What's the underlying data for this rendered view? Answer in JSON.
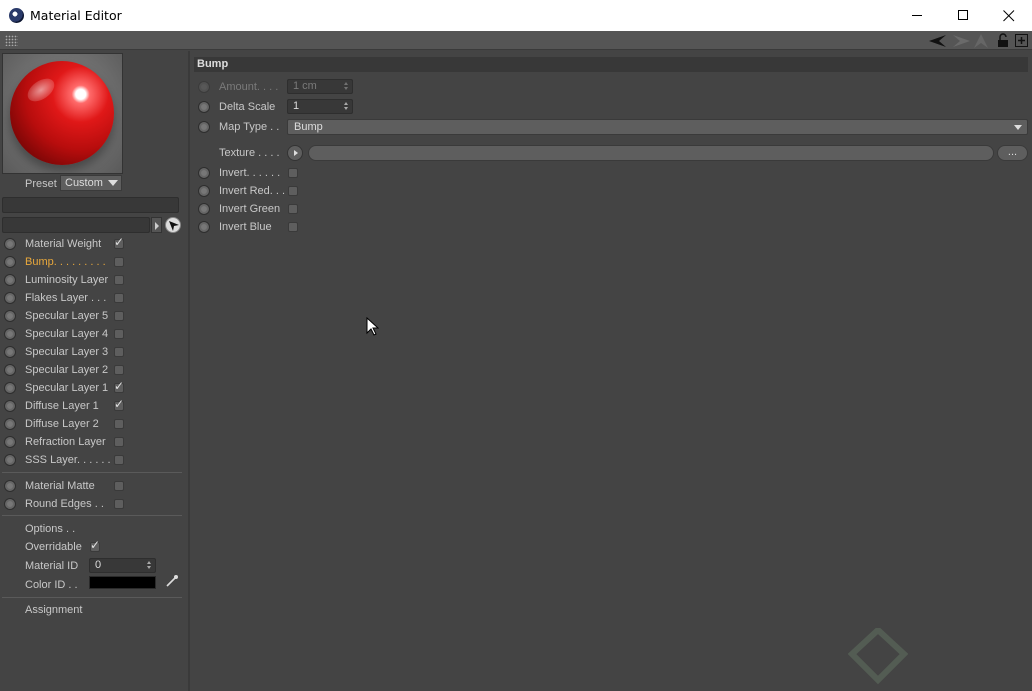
{
  "window": {
    "title": "Material Editor",
    "minimize_icon": "minimize-icon",
    "maximize_icon": "maximize-icon",
    "close_icon": "close-icon"
  },
  "toolbar": {
    "icons": [
      "grip-icon",
      "back-arrow-icon",
      "forward-arrow-icon",
      "up-arrow-icon",
      "lock-icon",
      "new-panel-icon"
    ]
  },
  "preview": {
    "preset_label": "Preset",
    "preset_value": "Custom"
  },
  "channels": [
    {
      "label": "Material Weight",
      "checked": true,
      "active": false
    },
    {
      "label": "Bump. . . . . . . . .",
      "checked": false,
      "active": true
    },
    {
      "label": "Luminosity Layer",
      "checked": false,
      "active": false
    },
    {
      "label": "Flakes Layer . . .",
      "checked": false,
      "active": false
    },
    {
      "label": "Specular Layer 5",
      "checked": false,
      "active": false
    },
    {
      "label": "Specular Layer 4",
      "checked": false,
      "active": false
    },
    {
      "label": "Specular Layer 3",
      "checked": false,
      "active": false
    },
    {
      "label": "Specular Layer 2",
      "checked": false,
      "active": false
    },
    {
      "label": "Specular Layer 1",
      "checked": true,
      "active": false
    },
    {
      "label": "Diffuse Layer 1",
      "checked": true,
      "active": false
    },
    {
      "label": "Diffuse Layer 2",
      "checked": false,
      "active": false
    },
    {
      "label": "Refraction Layer",
      "checked": false,
      "active": false
    },
    {
      "label": "SSS Layer. . . . . .",
      "checked": false,
      "active": false
    }
  ],
  "extras": [
    {
      "label": "Material Matte",
      "checked": false
    },
    {
      "label": "Round Edges . .",
      "checked": false
    }
  ],
  "options": {
    "options_label": "Options . .",
    "overridable_label": "Overridable",
    "overridable_checked": true,
    "material_id_label": "Material ID",
    "material_id_value": "0",
    "color_id_label": "Color ID . .",
    "color_id_value": "#000000",
    "assignment_label": "Assignment"
  },
  "bump": {
    "header": "Bump",
    "amount_label": "Amount. . . .",
    "amount_value": "1 cm",
    "delta_scale_label": "Delta Scale",
    "delta_scale_value": "1",
    "map_type_label": "Map Type . .",
    "map_type_value": "Bump",
    "texture_label": "Texture . . . .",
    "texture_more": "...",
    "invert_label": "Invert. . . . . .",
    "invert_red_label": "Invert Red. . .",
    "invert_green_label": "Invert Green",
    "invert_blue_label": "Invert Blue"
  }
}
